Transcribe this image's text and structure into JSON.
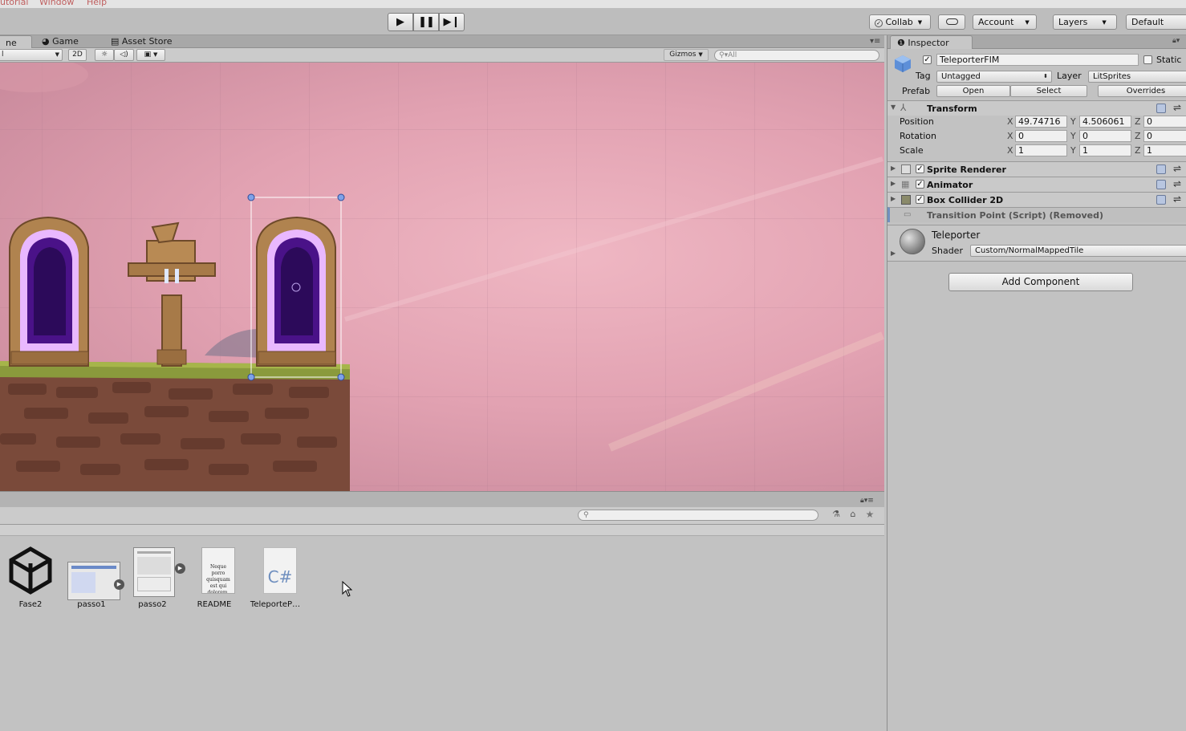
{
  "menu": [
    "utorial",
    "Window",
    "Help"
  ],
  "toolbar": {
    "play_icon": "play-icon",
    "pause_icon": "pause-icon",
    "step_icon": "step-icon",
    "collab": "Collab",
    "account": "Account",
    "layers": "Layers",
    "layout": "Default"
  },
  "scene_tabs": {
    "scene": "ne",
    "game": "Game",
    "asset_store": "Asset Store"
  },
  "scene_toolbar": {
    "shading": "l",
    "mode_2d": "2D",
    "gizmos": "Gizmos",
    "search_placeholder": "All"
  },
  "project": {
    "assets": [
      {
        "name": "Fase2",
        "kind": "unity-scene"
      },
      {
        "name": "passo1",
        "kind": "image"
      },
      {
        "name": "passo2",
        "kind": "image"
      },
      {
        "name": "README",
        "kind": "text",
        "preview": "Neque porro quisquam est qui dolorem."
      },
      {
        "name": "TeleporteP…",
        "kind": "csharp",
        "glyph": "C#"
      }
    ]
  },
  "inspector": {
    "tab": "Inspector",
    "object_name": "TeleporterFIM",
    "static_label": "Static",
    "tag_label": "Tag",
    "tag_value": "Untagged",
    "layer_label": "Layer",
    "layer_value": "LitSprites",
    "prefab_label": "Prefab",
    "open": "Open",
    "select": "Select",
    "overrides": "Overrides",
    "transform": {
      "title": "Transform",
      "position_label": "Position",
      "rotation_label": "Rotation",
      "scale_label": "Scale",
      "axis_x": "X",
      "axis_y": "Y",
      "axis_z": "Z",
      "position": {
        "x": "49.74716",
        "y": "4.506061",
        "z": "0"
      },
      "rotation": {
        "x": "0",
        "y": "0",
        "z": "0"
      },
      "scale": {
        "x": "1",
        "y": "1",
        "z": "1"
      }
    },
    "components": [
      "Sprite Renderer",
      "Animator",
      "Box Collider 2D"
    ],
    "removed_component": "Transition Point (Script) (Removed)",
    "material": {
      "name": "Teleporter",
      "shader_label": "Shader",
      "shader_value": "Custom/NormalMappedTile"
    },
    "add_component": "Add Component"
  },
  "colors": {
    "scene_bg": "#e6a8b6",
    "portal": "#6a1fc0",
    "selection": "#4a78d8"
  }
}
